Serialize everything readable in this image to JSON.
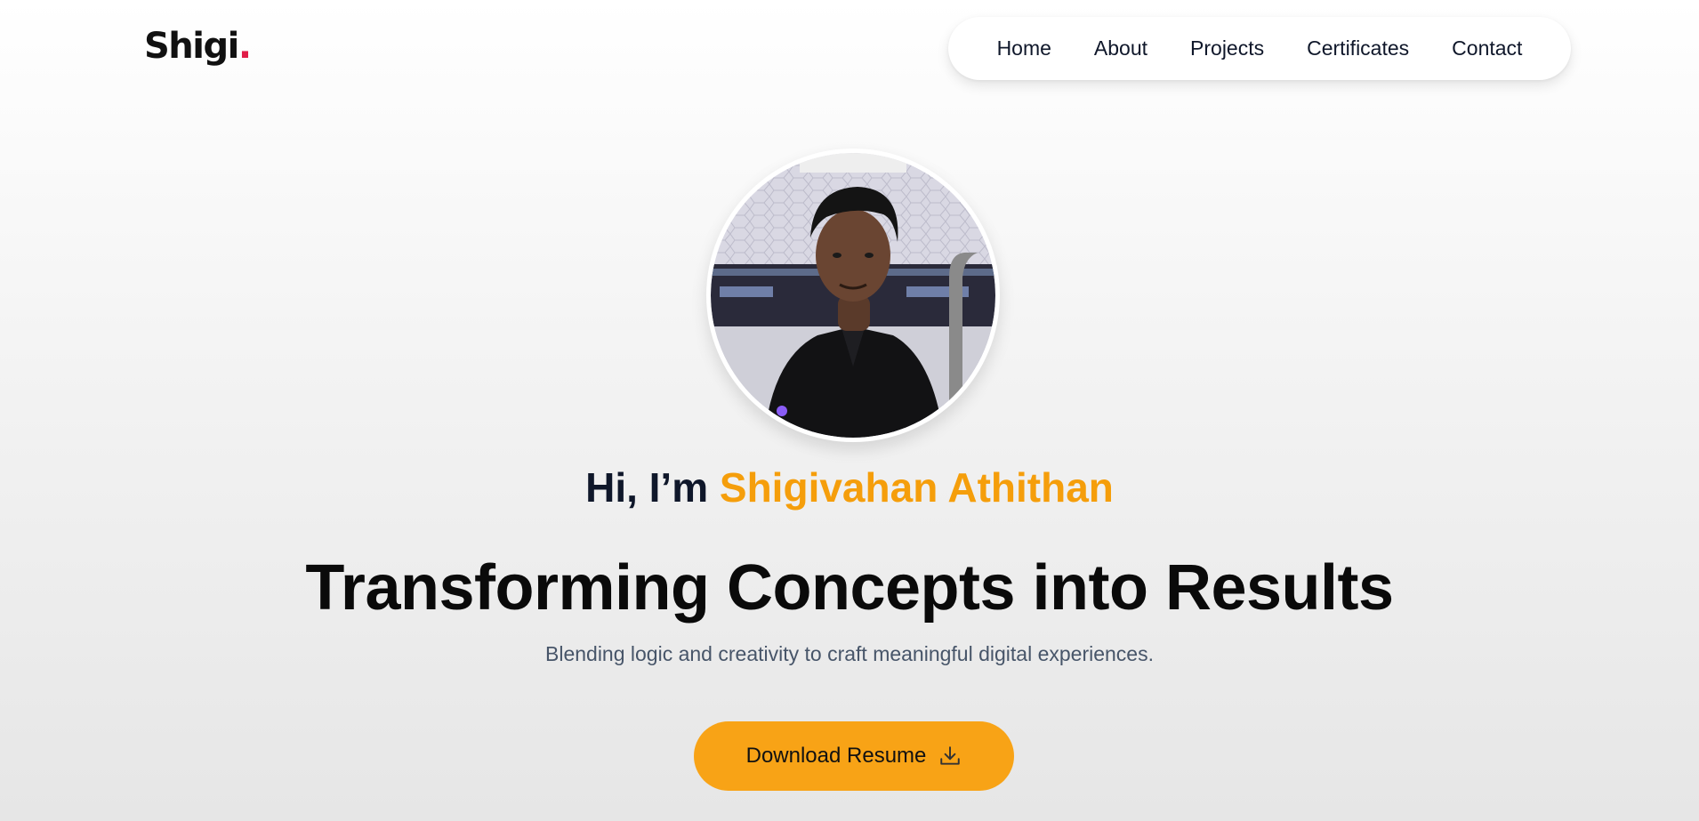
{
  "brand": {
    "name": "Shigi",
    "dot": ".",
    "dot_color": "#e11d48"
  },
  "nav": {
    "items": [
      {
        "label": "Home"
      },
      {
        "label": "About"
      },
      {
        "label": "Projects"
      },
      {
        "label": "Certificates"
      },
      {
        "label": "Contact"
      }
    ]
  },
  "hero": {
    "greeting_prefix": "Hi, I’m ",
    "name": "Shigivahan Athithan",
    "headline": "Transforming Concepts into Results",
    "subtitle": "Blending logic and creativity to craft meaningful digital experiences.",
    "cta_label": "Download Resume",
    "cta_icon": "download-icon"
  },
  "colors": {
    "accent": "#f59e0b",
    "button": "#f8a316",
    "text": "#0f172a",
    "muted": "#475569"
  }
}
